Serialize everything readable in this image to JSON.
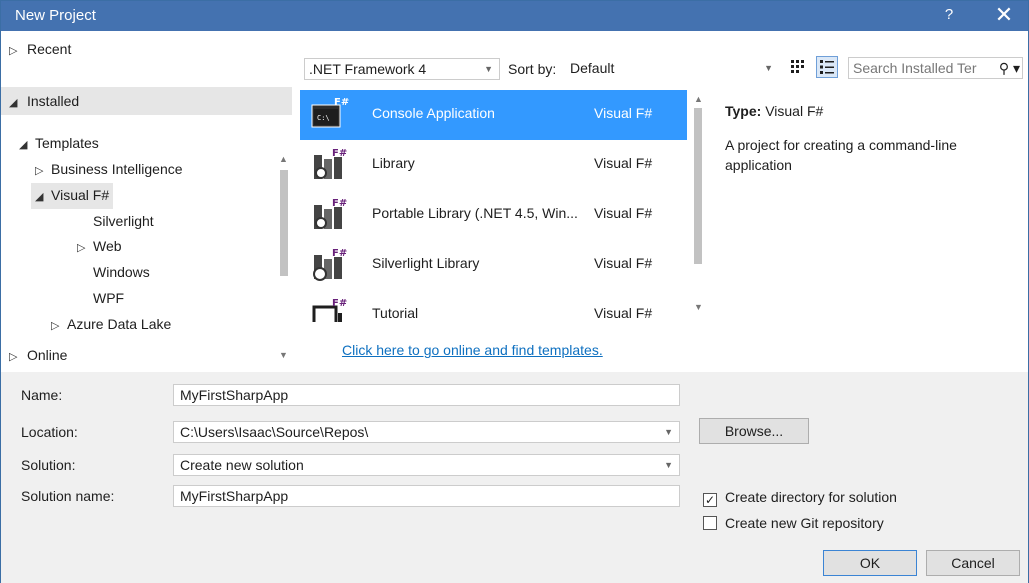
{
  "window": {
    "title": "New Project",
    "help_label": "?",
    "close_label": "✕"
  },
  "categories": {
    "recent": "Recent",
    "installed": "Installed",
    "online": "Online"
  },
  "tree": [
    {
      "label": "Templates",
      "toggle": "◢"
    },
    {
      "label": "Business Intelligence",
      "toggle": "▷"
    },
    {
      "label": "Visual F#",
      "toggle": "◢"
    },
    {
      "label": "Silverlight",
      "toggle": ""
    },
    {
      "label": "Web",
      "toggle": "▷"
    },
    {
      "label": "Windows",
      "toggle": ""
    },
    {
      "label": "WPF",
      "toggle": ""
    },
    {
      "label": "Azure Data Lake",
      "toggle": "▷"
    }
  ],
  "toolbar": {
    "framework": ".NET Framework 4",
    "sort_label": "Sort by:",
    "sort_value": "Default",
    "search_placeholder": "Search Installed Ter"
  },
  "templates": [
    {
      "name": "Console Application",
      "language": "Visual F#",
      "icon": "console-app-icon"
    },
    {
      "name": "Library",
      "language": "Visual F#",
      "icon": "library-icon"
    },
    {
      "name": "Portable Library (.NET 4.5, Win...",
      "language": "Visual F#",
      "icon": "portable-library-icon"
    },
    {
      "name": "Silverlight Library",
      "language": "Visual F#",
      "icon": "silverlight-library-icon"
    },
    {
      "name": "Tutorial",
      "language": "Visual F#",
      "icon": "tutorial-icon"
    }
  ],
  "online_link": "Click here to go online and find templates.",
  "details": {
    "type_label": "Type:",
    "type_value": "Visual F#",
    "description": "A project for creating a command-line application"
  },
  "form": {
    "name_label": "Name:",
    "name_value": "MyFirstSharpApp",
    "location_label": "Location:",
    "location_value": "C:\\Users\\Isaac\\Source\\Repos\\",
    "solution_label": "Solution:",
    "solution_value": "Create new solution",
    "solution_name_label": "Solution name:",
    "solution_name_value": "MyFirstSharpApp",
    "browse_label": "Browse...",
    "create_directory_label": "Create directory for solution",
    "create_directory_checked": true,
    "create_git_label": "Create new Git repository",
    "create_git_checked": false,
    "ok_label": "OK",
    "cancel_label": "Cancel"
  },
  "colors": {
    "title_bar": "#4472b0",
    "selection": "#3399ff",
    "link": "#0e70c0",
    "fsharp_purple": "#68217a"
  }
}
